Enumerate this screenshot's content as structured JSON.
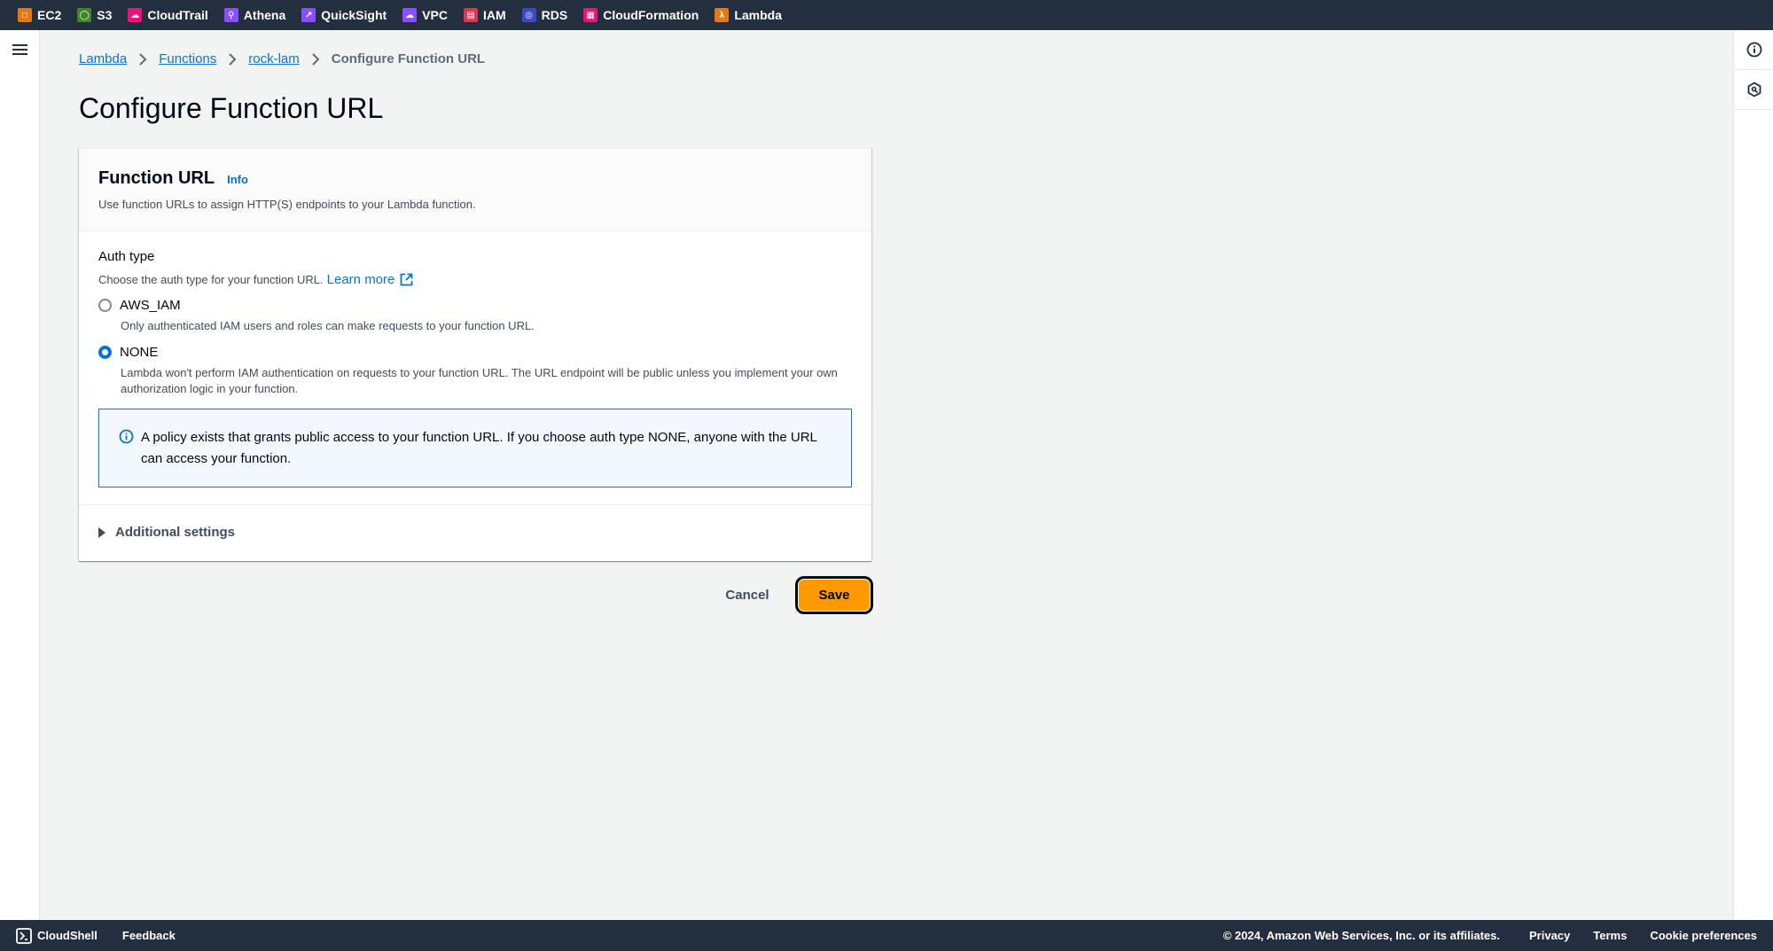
{
  "topbar": {
    "services": [
      {
        "label": "EC2",
        "icon": "ec2-icon",
        "color": "#e47911"
      },
      {
        "label": "S3",
        "icon": "s3-icon",
        "color": "#3f8624"
      },
      {
        "label": "CloudTrail",
        "icon": "cloudtrail-icon",
        "color": "#e7157b"
      },
      {
        "label": "Athena",
        "icon": "athena-icon",
        "color": "#8c4fff"
      },
      {
        "label": "QuickSight",
        "icon": "quicksight-icon",
        "color": "#8c4fff"
      },
      {
        "label": "VPC",
        "icon": "vpc-icon",
        "color": "#8c4fff"
      },
      {
        "label": "IAM",
        "icon": "iam-icon",
        "color": "#dd344c"
      },
      {
        "label": "RDS",
        "icon": "rds-icon",
        "color": "#3b48cc"
      },
      {
        "label": "CloudFormation",
        "icon": "cloudformation-icon",
        "color": "#e7157b"
      },
      {
        "label": "Lambda",
        "icon": "lambda-icon",
        "color": "#e47911"
      }
    ]
  },
  "breadcrumb": {
    "items": [
      "Lambda",
      "Functions",
      "rock-lam"
    ],
    "current": "Configure Function URL"
  },
  "page": {
    "title": "Configure Function URL"
  },
  "card": {
    "title": "Function URL",
    "info": "Info",
    "description": "Use function URLs to assign HTTP(S) endpoints to your Lambda function.",
    "auth": {
      "label": "Auth type",
      "description": "Choose the auth type for your function URL.",
      "learn_more": "Learn more",
      "selected": "NONE",
      "options": [
        {
          "label": "AWS_IAM",
          "description": "Only authenticated IAM users and roles can make requests to your function URL.",
          "checked": false
        },
        {
          "label": "NONE",
          "description": "Lambda won't perform IAM authentication on requests to your function URL. The URL endpoint will be public unless you implement your own authorization logic in your function.",
          "checked": true
        }
      ]
    },
    "alert": "A policy exists that grants public access to your function URL. If you choose auth type NONE, anyone with the URL can access your function.",
    "additional_settings": "Additional settings"
  },
  "actions": {
    "cancel": "Cancel",
    "save": "Save"
  },
  "footer": {
    "cloudshell": "CloudShell",
    "feedback": "Feedback",
    "copyright": "© 2024, Amazon Web Services, Inc. or its affiliates.",
    "privacy": "Privacy",
    "terms": "Terms",
    "cookies": "Cookie preferences"
  },
  "colors": {
    "nav_bg": "#232f3e",
    "link": "#0972d3",
    "primary_button": "#ff9900",
    "page_bg": "#f2f3f3"
  }
}
